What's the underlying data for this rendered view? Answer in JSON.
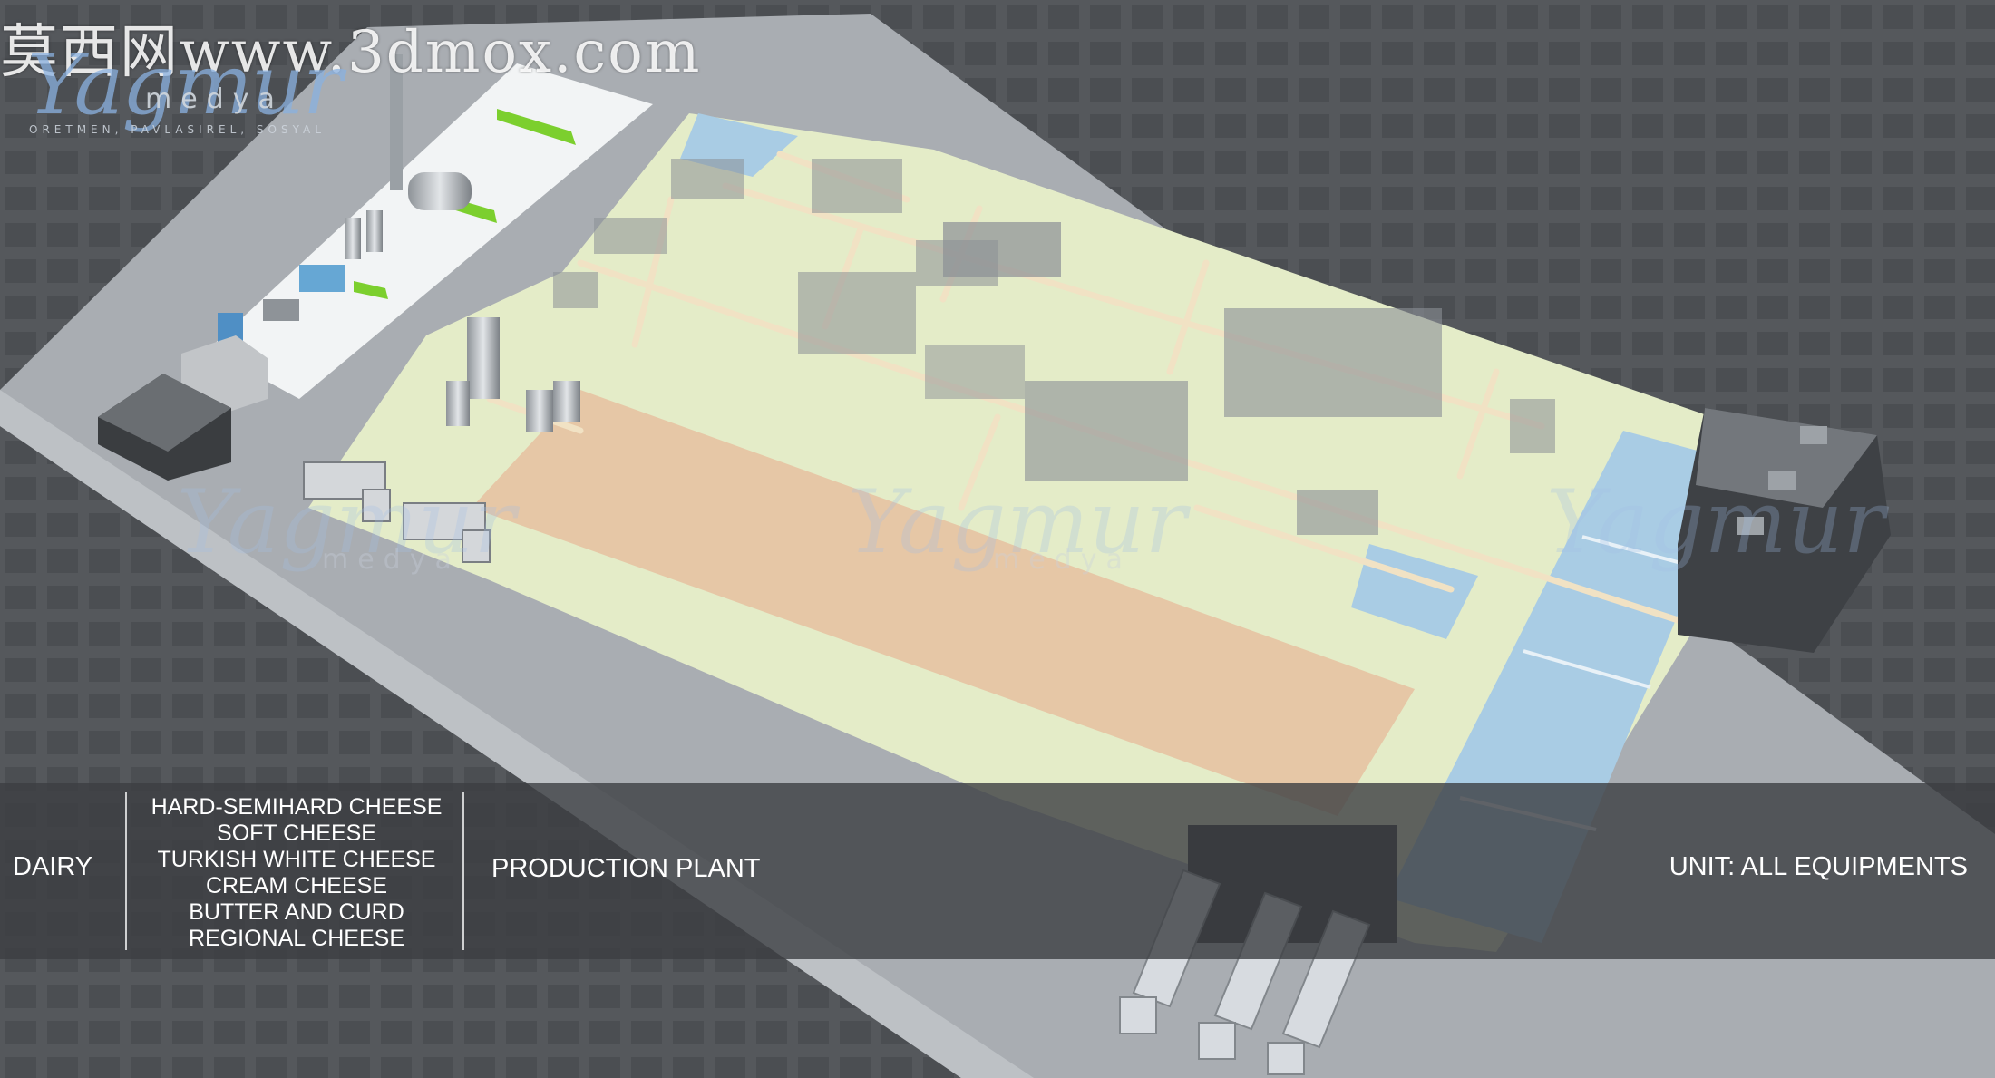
{
  "watermark": {
    "text": "莫西网www.3dmox.com"
  },
  "brand": {
    "script": "Yagmur",
    "sub": "medya",
    "tagline": "ORETMEN, PAVLASIREL, SOSYAL"
  },
  "info_bar": {
    "category": "DAIRY",
    "products": [
      "HARD-SEMIHARD CHEESE",
      "SOFT CHEESE",
      "TURKISH WHITE CHEESE",
      "CREAM CHEESE",
      "BUTTER AND CURD",
      "REGIONAL CHEESE"
    ],
    "facility": "PRODUCTION PLANT",
    "unit": "UNIT: ALL EQUIPMENTS"
  },
  "colors": {
    "background": "#55585c",
    "ground": "#a9adb2",
    "floor": "#e4ecc8",
    "warehouse_floor": "#e6c7a6",
    "cold_room": "#a9cce4",
    "wall": "#f1e2c4",
    "accent_green": "#7ccf2e",
    "bar": "#3c3e42"
  }
}
